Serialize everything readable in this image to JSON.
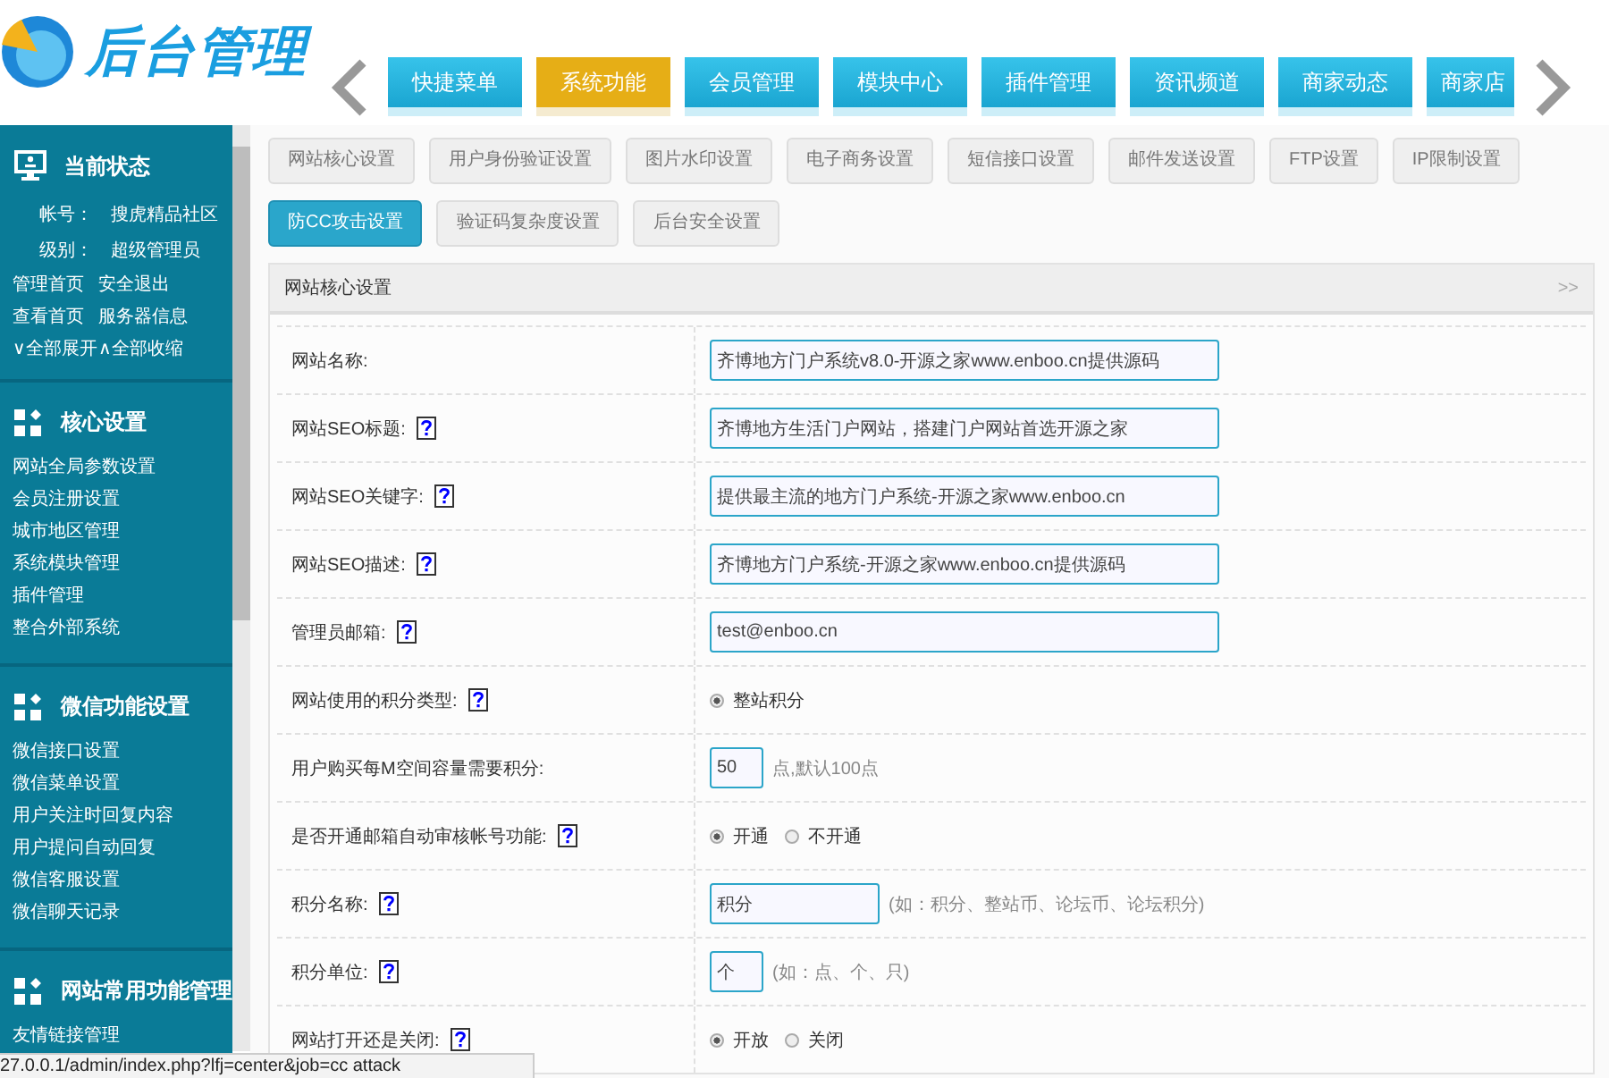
{
  "logo": {
    "title": "后台管理"
  },
  "top_tabs": [
    {
      "label": "快捷菜单",
      "selected": false
    },
    {
      "label": "系统功能",
      "selected": true
    },
    {
      "label": "会员管理",
      "selected": false
    },
    {
      "label": "模块中心",
      "selected": false
    },
    {
      "label": "插件管理",
      "selected": false
    },
    {
      "label": "资讯频道",
      "selected": false
    },
    {
      "label": "商家动态",
      "selected": false
    },
    {
      "label": "商家店",
      "selected": false
    }
  ],
  "sidebar": {
    "status": {
      "title": "当前状态",
      "account_label": "帐号：",
      "account": "搜虎精品社区",
      "level_label": "级别：",
      "level": "超级管理员",
      "links": [
        "管理首页",
        "安全退出",
        "查看首页",
        "服务器信息"
      ],
      "expand": "∨全部展开",
      "collapse": "∧全部收缩"
    },
    "sections": [
      {
        "title": "核心设置",
        "items": [
          "网站全局参数设置",
          "会员注册设置",
          "城市地区管理",
          "系统模块管理",
          "插件管理",
          "整合外部系统"
        ]
      },
      {
        "title": "微信功能设置",
        "items": [
          "微信接口设置",
          "微信菜单设置",
          "用户关注时回复内容",
          "用户提问自动回复",
          "微信客服设置",
          "微信聊天记录"
        ]
      },
      {
        "title": "网站常用功能管理",
        "items": [
          "友情链接管理"
        ]
      }
    ]
  },
  "sub_tabs": [
    {
      "label": "网站核心设置",
      "selected": false
    },
    {
      "label": "用户身份验证设置",
      "selected": false
    },
    {
      "label": "图片水印设置",
      "selected": false
    },
    {
      "label": "电子商务设置",
      "selected": false
    },
    {
      "label": "短信接口设置",
      "selected": false
    },
    {
      "label": "邮件发送设置",
      "selected": false
    },
    {
      "label": "FTP设置",
      "selected": false
    },
    {
      "label": "IP限制设置",
      "selected": false
    },
    {
      "label": "防CC攻击设置",
      "selected": true
    },
    {
      "label": "验证码复杂度设置",
      "selected": false
    },
    {
      "label": "后台安全设置",
      "selected": false
    }
  ],
  "panel": {
    "title": "网站核心设置",
    "more": ">>",
    "rows": [
      {
        "kind": "text",
        "label": "网站名称:",
        "help": false,
        "value": "齐博地方门户系统v8.0-开源之家www.enboo.cn提供源码"
      },
      {
        "kind": "text",
        "label": "网站SEO标题:",
        "help": true,
        "value": "齐博地方生活门户网站，搭建门户网站首选开源之家"
      },
      {
        "kind": "text",
        "label": "网站SEO关键字:",
        "help": true,
        "value": "提供最主流的地方门户系统-开源之家www.enboo.cn"
      },
      {
        "kind": "text",
        "label": "网站SEO描述:",
        "help": true,
        "value": "齐博地方门户系统-开源之家www.enboo.cn提供源码"
      },
      {
        "kind": "text",
        "label": "管理员邮箱:",
        "help": true,
        "value": "test@enboo.cn"
      },
      {
        "kind": "radio",
        "label": "网站使用的积分类型:",
        "help": true,
        "options": [
          {
            "label": "整站积分",
            "selected": true
          }
        ]
      },
      {
        "kind": "short",
        "label": "用户购买每M空间容量需要积分:",
        "help": false,
        "value": "50",
        "note": "点,默认100点"
      },
      {
        "kind": "radio",
        "label": "是否开通邮箱自动审核帐号功能:",
        "help": true,
        "options": [
          {
            "label": "开通",
            "selected": true
          },
          {
            "label": "不开通",
            "selected": false
          }
        ]
      },
      {
        "kind": "medium",
        "label": "积分名称:",
        "help": true,
        "value": "积分",
        "note": "(如：积分、整站币、论坛币、论坛积分)"
      },
      {
        "kind": "short",
        "label": "积分单位:",
        "help": true,
        "value": "个",
        "note": "(如：点、个、只)"
      },
      {
        "kind": "radio",
        "label": "网站打开还是关闭:",
        "help": true,
        "options": [
          {
            "label": "开放",
            "selected": true
          },
          {
            "label": "关闭",
            "selected": false
          }
        ]
      }
    ]
  },
  "status_bar": {
    "url": "27.0.0.1/admin/index.php?lfj=center&job=cc attack"
  }
}
